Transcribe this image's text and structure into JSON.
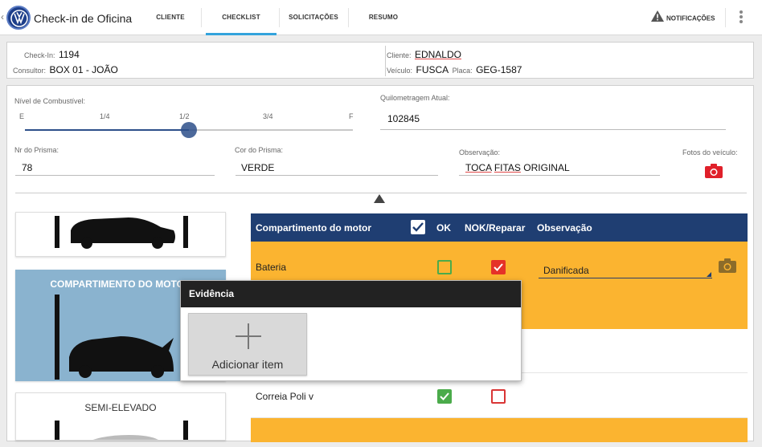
{
  "app": {
    "title": "Check-in de Oficina",
    "logo": "vw-logo-icon"
  },
  "tabs": [
    {
      "label": "CLIENTE",
      "active": false
    },
    {
      "label": "CHECKLIST",
      "active": true
    },
    {
      "label": "SOLICITAÇÕES",
      "active": false
    },
    {
      "label": "RESUMO",
      "active": false
    }
  ],
  "topbar": {
    "notifications_label": "NOTIFICAÇÕES",
    "notifications_icon": "warning-icon",
    "menu_icon": "kebab-menu-icon"
  },
  "info": {
    "checkin_label": "Check-In:",
    "checkin_value": "1194",
    "consultor_label": "Consultor:",
    "consultor_value": "BOX 01 - JOÃO",
    "cliente_label": "Cliente:",
    "cliente_value": "EDNALDO",
    "veiculo_label": "Veículo:",
    "veiculo_value": "FUSCA",
    "placa_label": "Placa:",
    "placa_value": "GEG-1587"
  },
  "form": {
    "combustivel_label": "Nível de Combustível:",
    "combustivel_ticks": [
      "E",
      "1/4",
      "1/2",
      "3/4",
      "F"
    ],
    "combustivel_level": 0.5,
    "quilometragem_label": "Quilometragem Atual:",
    "quilometragem_value": "102845",
    "prisma_label": "Nr do Prisma:",
    "prisma_value": "78",
    "cor_prisma_label": "Cor do Prisma:",
    "cor_prisma_value": "VERDE",
    "observacao_label": "Observação:",
    "observacao_words": [
      "TOCA",
      "FITAS",
      "ORIGINAL"
    ],
    "fotos_label": "Fotos do veículo:",
    "fotos_icon": "camera-icon"
  },
  "tiles": [
    {
      "label": "",
      "active": false
    },
    {
      "label": "COMPARTIMENTO DO MOTOR",
      "active": true
    },
    {
      "label": "SEMI-ELEVADO",
      "active": false
    }
  ],
  "checklist": {
    "headers": {
      "item": "Compartimento do motor",
      "ok": "OK",
      "nok": "NOK/Reparar",
      "obs": "Observação"
    },
    "rows": [
      {
        "name": "Bateria",
        "ok": false,
        "nok": true,
        "observation": "Danificada"
      },
      {
        "name": "Correia Poli v",
        "ok": true,
        "nok": false,
        "observation": ""
      }
    ]
  },
  "popup": {
    "title": "Evidência",
    "add_label": "Adicionar item",
    "add_icon": "plus-icon"
  },
  "colors": {
    "navy": "#1f3e72",
    "yellow": "#fbb430",
    "accent": "#33a3dc",
    "green": "#4bab4b",
    "red": "#e53228"
  }
}
